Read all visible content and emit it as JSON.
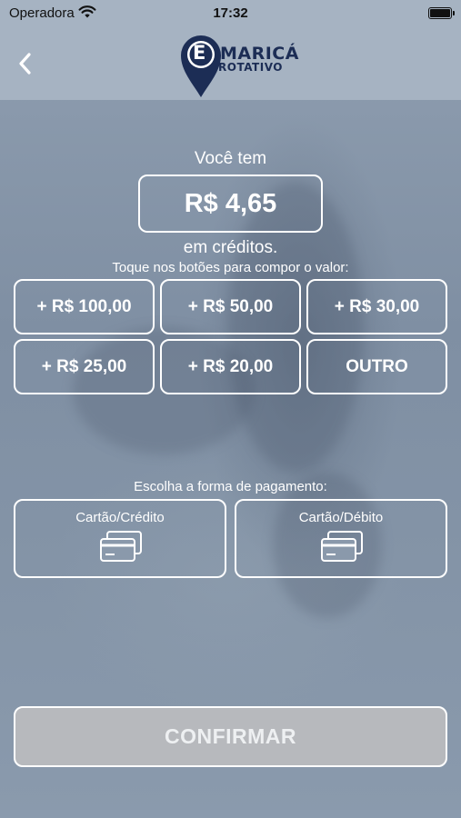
{
  "status_bar": {
    "carrier": "Operadora",
    "time": "17:32",
    "icons": [
      "wifi-icon",
      "battery-icon"
    ]
  },
  "nav": {
    "back_icon": "chevron-left-icon",
    "logo": {
      "letter": "E",
      "line1": "MARICÁ",
      "line2": "ROTATIVO"
    }
  },
  "credits": {
    "prefix": "Você tem",
    "balance": "R$ 4,65",
    "suffix": "em créditos."
  },
  "compose": {
    "instruction": "Toque nos botões para compor o valor:",
    "buttons": [
      {
        "label": "+ R$ 100,00"
      },
      {
        "label": "+ R$ 50,00"
      },
      {
        "label": "+ R$ 30,00"
      },
      {
        "label": "+ R$ 25,00"
      },
      {
        "label": "+ R$ 20,00"
      },
      {
        "label": "OUTRO"
      }
    ]
  },
  "payment": {
    "label": "Escolha a forma de pagamento:",
    "options": [
      {
        "label": "Cartão/Crédito",
        "icon": "credit-card-icon"
      },
      {
        "label": "Cartão/Débito",
        "icon": "credit-card-icon"
      }
    ]
  },
  "confirm_label": "CONFIRMAR",
  "colors": {
    "header_bg": "#a6b3c2",
    "logo_navy": "#1c2d55",
    "confirm_bg": "#b7b9bd",
    "outline": "#ffffff"
  }
}
